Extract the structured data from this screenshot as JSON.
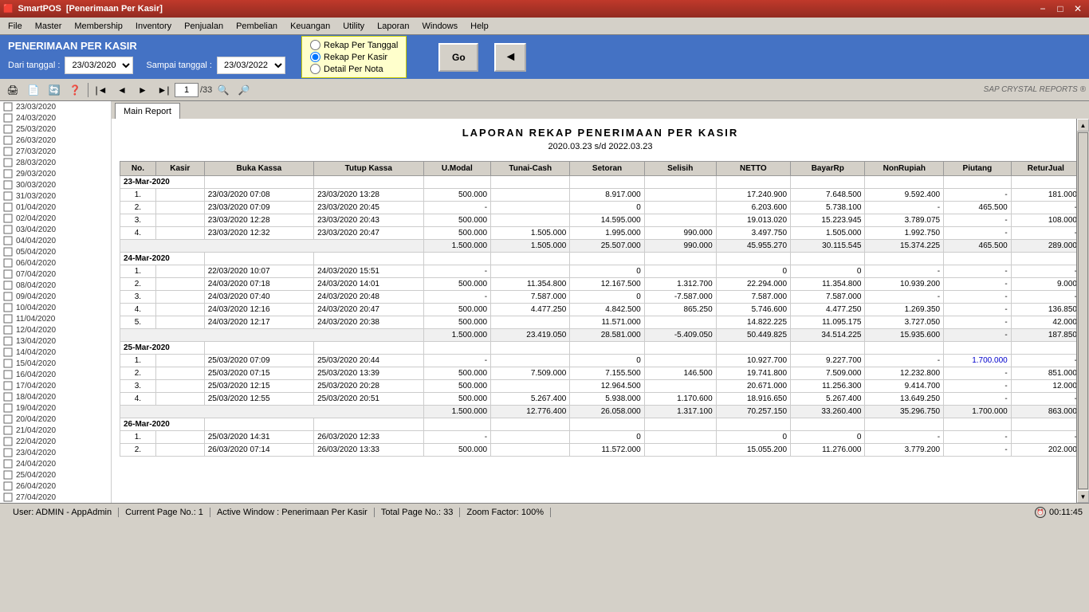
{
  "titlebar": {
    "app_name": "SmartPOS",
    "window_title": "[Penerimaan Per Kasir]",
    "minimize": "−",
    "maximize": "□",
    "close": "✕"
  },
  "menubar": {
    "items": [
      "File",
      "Master",
      "Membership",
      "Inventory",
      "Penjualan",
      "Pembelian",
      "Keuangan",
      "Utility",
      "Laporan",
      "Windows",
      "Help"
    ]
  },
  "header": {
    "title": "PENERIMAAN PER KASIR",
    "dari_label": "Dari tanggal :",
    "dari_value": "23/03/2020",
    "sampai_label": "Sampai tanggal :",
    "sampai_value": "23/03/2022",
    "radio_options": [
      "Rekap Per Tanggal",
      "Rekap Per Kasir",
      "Detail Per Nota"
    ],
    "radio_selected": 1,
    "go_label": "Go",
    "back_arrow": "◄"
  },
  "toolbar": {
    "page_current": "1",
    "page_total": "/33",
    "crystal_label": "SAP CRYSTAL REPORTS ®"
  },
  "sidebar": {
    "items": [
      "23/03/2020",
      "24/03/2020",
      "25/03/2020",
      "26/03/2020",
      "27/03/2020",
      "28/03/2020",
      "29/03/2020",
      "30/03/2020",
      "31/03/2020",
      "01/04/2020",
      "02/04/2020",
      "03/04/2020",
      "04/04/2020",
      "05/04/2020",
      "06/04/2020",
      "07/04/2020",
      "08/04/2020",
      "09/04/2020",
      "10/04/2020",
      "11/04/2020",
      "12/04/2020",
      "13/04/2020",
      "14/04/2020",
      "15/04/2020",
      "16/04/2020",
      "17/04/2020",
      "18/04/2020",
      "19/04/2020",
      "20/04/2020",
      "21/04/2020",
      "22/04/2020",
      "23/04/2020",
      "24/04/2020",
      "25/04/2020",
      "26/04/2020",
      "27/04/2020"
    ]
  },
  "report": {
    "title": "LAPORAN REKAP PENERIMAAN PER KASIR",
    "subtitle": "2020.03.23 s/d 2022.03.23",
    "tab": "Main Report",
    "columns": [
      "No.",
      "Kasir",
      "Buka Kassa",
      "Tutup Kassa",
      "U.Modal",
      "Tunai-Cash",
      "Setoran",
      "Selisih",
      "NETTO",
      "BayarRp",
      "NonRupiah",
      "Piutang",
      "ReturJual"
    ],
    "date_groups": [
      {
        "date": "23-Mar-2020",
        "rows": [
          {
            "no": "1.",
            "kasir": "",
            "buka": "23/03/2020 07:08",
            "tutup": "23/03/2020 13:28",
            "umodal": "500.000",
            "tunai": "",
            "setoran": "8.917.000",
            "selisih": "",
            "netto": "17.240.900",
            "bayar": "7.648.500",
            "nonrupiah": "9.592.400",
            "piutang": "-",
            "returl": "181.000"
          },
          {
            "no": "2.",
            "kasir": "",
            "buka": "23/03/2020 07:09",
            "tutup": "23/03/2020 20:45",
            "umodal": "-",
            "tunai": "",
            "setoran": "0",
            "selisih": "",
            "netto": "6.203.600",
            "bayar": "5.738.100",
            "nonrupiah": "-",
            "piutang": "465.500",
            "returl": "-"
          },
          {
            "no": "3.",
            "kasir": "",
            "buka": "23/03/2020 12:28",
            "tutup": "23/03/2020 20:43",
            "umodal": "500.000",
            "tunai": "",
            "setoran": "14.595.000",
            "selisih": "",
            "netto": "19.013.020",
            "bayar": "15.223.945",
            "nonrupiah": "3.789.075",
            "piutang": "-",
            "returl": "108.000"
          },
          {
            "no": "4.",
            "kasir": "",
            "buka": "23/03/2020 12:32",
            "tutup": "23/03/2020 20:47",
            "umodal": "500.000",
            "tunai": "1.505.000",
            "setoran": "1.995.000",
            "selisih": "990.000",
            "netto": "3.497.750",
            "bayar": "1.505.000",
            "nonrupiah": "1.992.750",
            "piutang": "-",
            "returl": "-"
          }
        ],
        "subtotal": {
          "umodal": "1.500.000",
          "tunai": "1.505.000",
          "setoran": "25.507.000",
          "selisih": "990.000",
          "netto": "45.955.270",
          "bayar": "30.115.545",
          "nonrupiah": "15.374.225",
          "piutang": "465.500",
          "returl": "289.000"
        }
      },
      {
        "date": "24-Mar-2020",
        "rows": [
          {
            "no": "1.",
            "kasir": "",
            "buka": "22/03/2020 10:07",
            "tutup": "24/03/2020 15:51",
            "umodal": "-",
            "tunai": "",
            "setoran": "0",
            "selisih": "",
            "netto": "0",
            "bayar": "0",
            "nonrupiah": "-",
            "piutang": "-",
            "returl": "-"
          },
          {
            "no": "2.",
            "kasir": "",
            "buka": "24/03/2020 07:18",
            "tutup": "24/03/2020 14:01",
            "umodal": "500.000",
            "tunai": "11.354.800",
            "setoran": "12.167.500",
            "selisih": "1.312.700",
            "netto": "22.294.000",
            "bayar": "11.354.800",
            "nonrupiah": "10.939.200",
            "piutang": "-",
            "returl": "9.000"
          },
          {
            "no": "3.",
            "kasir": "",
            "buka": "24/03/2020 07:40",
            "tutup": "24/03/2020 20:48",
            "umodal": "-",
            "tunai": "7.587.000",
            "setoran": "0",
            "selisih": "-7.587.000",
            "netto": "7.587.000",
            "bayar": "7.587.000",
            "nonrupiah": "-",
            "piutang": "-",
            "returl": "-"
          },
          {
            "no": "4.",
            "kasir": "",
            "buka": "24/03/2020 12:16",
            "tutup": "24/03/2020 20:47",
            "umodal": "500.000",
            "tunai": "4.477.250",
            "setoran": "4.842.500",
            "selisih": "865.250",
            "netto": "5.746.600",
            "bayar": "4.477.250",
            "nonrupiah": "1.269.350",
            "piutang": "-",
            "returl": "136.850"
          },
          {
            "no": "5.",
            "kasir": "",
            "buka": "24/03/2020 12:17",
            "tutup": "24/03/2020 20:38",
            "umodal": "500.000",
            "tunai": "",
            "setoran": "11.571.000",
            "selisih": "",
            "netto": "14.822.225",
            "bayar": "11.095.175",
            "nonrupiah": "3.727.050",
            "piutang": "-",
            "returl": "42.000"
          }
        ],
        "subtotal": {
          "umodal": "1.500.000",
          "tunai": "23.419.050",
          "setoran": "28.581.000",
          "selisih": "-5.409.050",
          "netto": "50.449.825",
          "bayar": "34.514.225",
          "nonrupiah": "15.935.600",
          "piutang": "-",
          "returl": "187.850"
        }
      },
      {
        "date": "25-Mar-2020",
        "rows": [
          {
            "no": "1.",
            "kasir": "",
            "buka": "25/03/2020 07:09",
            "tutup": "25/03/2020 20:44",
            "umodal": "-",
            "tunai": "",
            "setoran": "0",
            "selisih": "",
            "netto": "10.927.700",
            "bayar": "9.227.700",
            "nonrupiah": "-",
            "piutang": "1.700.000",
            "returl": "-"
          },
          {
            "no": "2.",
            "kasir": "",
            "buka": "25/03/2020 07:15",
            "tutup": "25/03/2020 13:39",
            "umodal": "500.000",
            "tunai": "7.509.000",
            "setoran": "7.155.500",
            "selisih": "146.500",
            "netto": "19.741.800",
            "bayar": "7.509.000",
            "nonrupiah": "12.232.800",
            "piutang": "-",
            "returl": "851.000"
          },
          {
            "no": "3.",
            "kasir": "",
            "buka": "25/03/2020 12:15",
            "tutup": "25/03/2020 20:28",
            "umodal": "500.000",
            "tunai": "",
            "setoran": "12.964.500",
            "selisih": "",
            "netto": "20.671.000",
            "bayar": "11.256.300",
            "nonrupiah": "9.414.700",
            "piutang": "-",
            "returl": "12.000"
          },
          {
            "no": "4.",
            "kasir": "",
            "buka": "25/03/2020 12:55",
            "tutup": "25/03/2020 20:51",
            "umodal": "500.000",
            "tunai": "5.267.400",
            "setoran": "5.938.000",
            "selisih": "1.170.600",
            "netto": "18.916.650",
            "bayar": "5.267.400",
            "nonrupiah": "13.649.250",
            "piutang": "-",
            "returl": "-"
          }
        ],
        "subtotal": {
          "umodal": "1.500.000",
          "tunai": "12.776.400",
          "setoran": "26.058.000",
          "selisih": "1.317.100",
          "netto": "70.257.150",
          "bayar": "33.260.400",
          "nonrupiah": "35.296.750",
          "piutang": "1.700.000",
          "returl": "863.000"
        }
      },
      {
        "date": "26-Mar-2020",
        "rows": [
          {
            "no": "1.",
            "kasir": "",
            "buka": "25/03/2020 14:31",
            "tutup": "26/03/2020 12:33",
            "umodal": "-",
            "tunai": "",
            "setoran": "0",
            "selisih": "",
            "netto": "0",
            "bayar": "0",
            "nonrupiah": "-",
            "piutang": "-",
            "returl": "-"
          },
          {
            "no": "2.",
            "kasir": "",
            "buka": "26/03/2020 07:14",
            "tutup": "26/03/2020 13:33",
            "umodal": "500.000",
            "tunai": "",
            "setoran": "11.572.000",
            "selisih": "",
            "netto": "15.055.200",
            "bayar": "11.276.000",
            "nonrupiah": "3.779.200",
            "piutang": "-",
            "returl": "202.000"
          }
        ],
        "subtotal": null
      }
    ]
  },
  "statusbar": {
    "user": "User: ADMIN - AppAdmin",
    "current_page": "Current Page No.: 1",
    "total_page": "Total Page No.: 33",
    "zoom": "Zoom Factor: 100%",
    "active_window": "Active Window : Penerimaan Per Kasir",
    "time": "00:11:45"
  }
}
